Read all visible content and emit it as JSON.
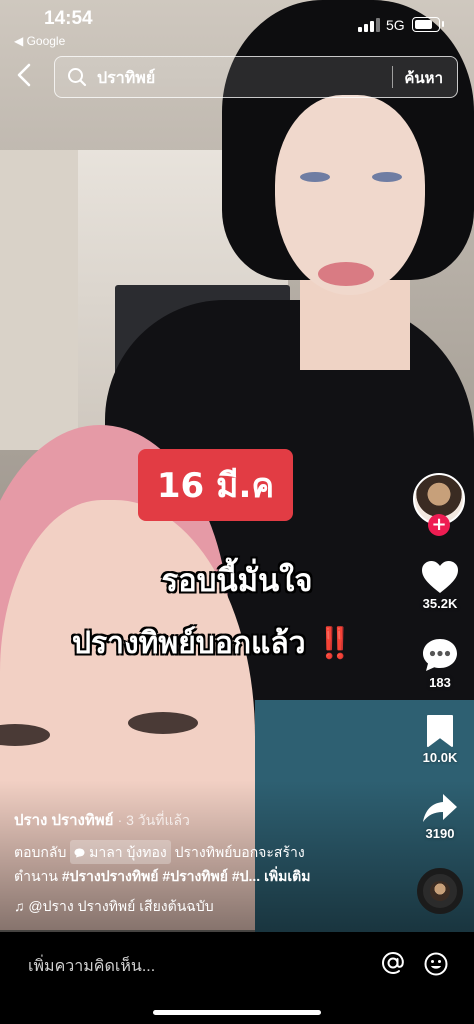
{
  "status_bar": {
    "time": "14:54",
    "back_app": "◀ Google",
    "network": "5G",
    "battery_level": 0.85
  },
  "search": {
    "query": "ปราทิพย์",
    "submit_label": "ค้นหา",
    "back_icon": "chevron-left-icon",
    "search_icon": "search-icon"
  },
  "overlay": {
    "date_badge": "16 มี.ค",
    "line1": "รอบนี้มั่นใจ",
    "line2": "ปรางทิพย์บอกแล้ว",
    "emphasis": "‼️",
    "badge_color": "#e23c44"
  },
  "actions": {
    "follow_label": "+",
    "likes": "35.2K",
    "comments": "183",
    "saves": "10.0K",
    "shares": "3190"
  },
  "post": {
    "author": "ปราง ปรางทิพย์",
    "age": "· 3 วันที่แล้ว",
    "reply_prefix": "ตอบกลับ",
    "reply_to": "มาลา บุ้งทอง",
    "reply_text": "ปรางทิพย์บอกจะสร้าง",
    "desc_line2": "ตำนาน",
    "hashtags": [
      "#ปรางปรางทิพย์",
      "#ปรางทิพย์",
      "#ป..."
    ],
    "more": "เพิ่มเติม",
    "sound": "♫ @ปราง ปรางทิพย์ เสียงต้นฉบับ"
  },
  "comment_bar": {
    "placeholder": "เพิ่มความคิดเห็น...",
    "mention_icon": "at-icon",
    "emoji_icon": "emoji-icon"
  }
}
